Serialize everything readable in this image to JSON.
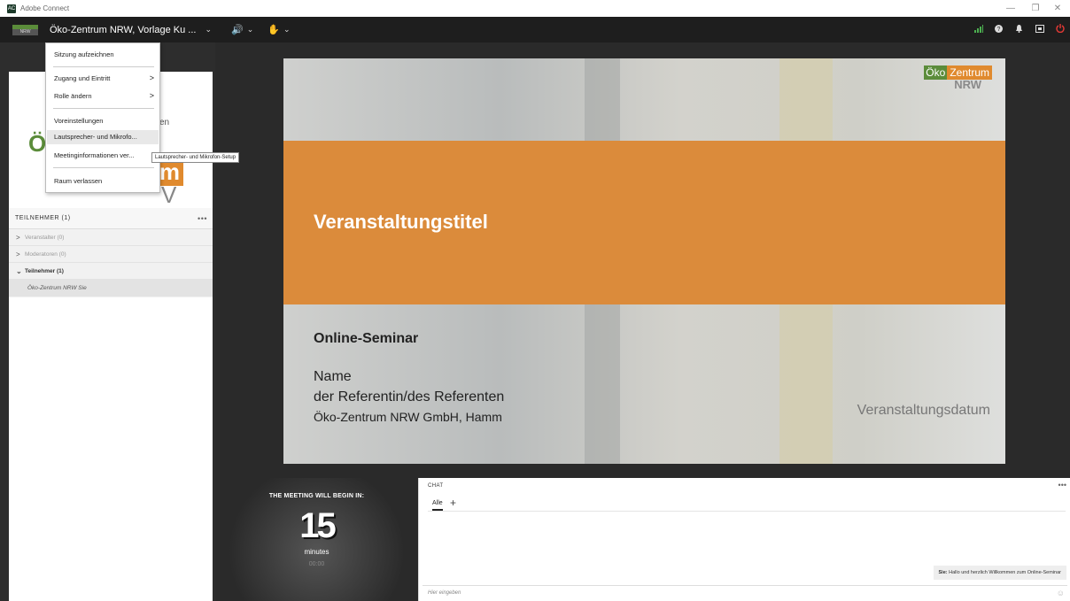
{
  "window": {
    "title": "Adobe Connect",
    "app_icon_label": "AC",
    "minimize": "—",
    "restore": "❐",
    "close": "✕"
  },
  "toolbar": {
    "room_name": "Öko-Zentrum NRW, Vorlage Ku ...",
    "brand_logo_text": "NRW",
    "chevron": "⌄",
    "audio_icon": "🔊",
    "hand_icon": "✋",
    "icons": [
      "signal-icon",
      "help-icon",
      "notifications-icon",
      "fullscreen-icon",
      "power-icon"
    ]
  },
  "menu": {
    "items": [
      {
        "label": "Sitzung aufzeichnen"
      },
      {
        "label": "Zugang und Eintritt",
        "submenu": ">"
      },
      {
        "label": "Rolle ändern",
        "submenu": ">"
      },
      {
        "label": "Voreinstellungen"
      },
      {
        "label": "Lautsprecher- und Mikrofo..."
      },
      {
        "label": "Meetinginformationen ver..."
      },
      {
        "label": "Raum verlassen"
      }
    ],
    "tooltip": "Lautsprecher- und Mikrofon-Setup"
  },
  "logo_pod": {
    "partial_text_left": "Ö",
    "partial_text_right": "um",
    "partial_text_en": "en",
    "partial_text_v": "V"
  },
  "attendees": {
    "title": "TEILNEHMER  (1)",
    "more": "•••",
    "groups": [
      {
        "label": "Veranstalter (0)",
        "chevron": ">"
      },
      {
        "label": "Moderatoren (0)",
        "chevron": ">"
      },
      {
        "label": "Teilnehmer (1)",
        "chevron": "⌄"
      }
    ],
    "person": "Öko-Zentrum NRW Sie"
  },
  "slide": {
    "logo_part1": "Öko",
    "logo_part2": "Zentrum",
    "logo_part3": "NRW",
    "event_title": "Veranstaltungstitel",
    "subtitle": "Online-Seminar",
    "name_line1": "Name",
    "name_line2": "der Referentin/des Referenten",
    "organization": "Öko-Zentrum NRW GmbH, Hamm",
    "date": "Veranstaltungsdatum"
  },
  "countdown": {
    "title": "THE MEETING WILL BEGIN IN:",
    "number": "15",
    "unit": "minutes",
    "time": "00:00"
  },
  "chat": {
    "title": "CHAT",
    "more": "•••",
    "tab_all": "Alle",
    "tab_add": "+",
    "message_sender": "Sie:",
    "message_text": "Hallo und herzlich Willkommen zum Online-Seminar",
    "input_placeholder": "Hier eingeben",
    "emoji": "☺"
  }
}
